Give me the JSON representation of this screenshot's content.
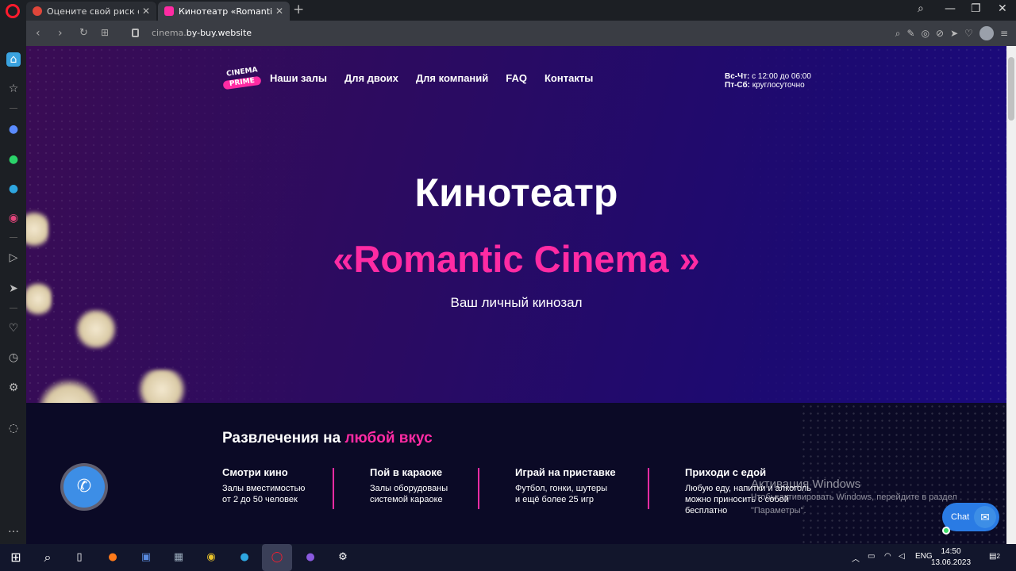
{
  "tabs": [
    {
      "title": "Оцените свой риск стать ж",
      "active": false
    },
    {
      "title": "Кинотеатр «Romantic Cine",
      "active": true
    }
  ],
  "window_controls": {
    "search": "⌕",
    "minimize": "—",
    "restore": "❐",
    "close": "✕"
  },
  "address": {
    "domain_prefix": "cinema.",
    "domain_main": "by-buy.website"
  },
  "page": {
    "logo": {
      "line1": "CINEMA",
      "line2": "PRIME"
    },
    "menu": [
      "Наши залы",
      "Для двоих",
      "Для компаний",
      "FAQ",
      "Контакты"
    ],
    "hours": [
      {
        "days": "Вс-Чт:",
        "time": " с 12:00 до 06:00"
      },
      {
        "days": "Пт-Сб:",
        "time": " круглосуточно"
      }
    ],
    "hero_title": "Кинотеатр",
    "hero_subtitle": "«Romantic Cinema »",
    "hero_tagline": "Ваш личный кинозал",
    "section_title_white": "Развлечения на ",
    "section_title_pink": "любой вкус",
    "features": [
      {
        "title": "Смотри кино",
        "desc": "Залы вместимостью\nот 2 до 50 человек"
      },
      {
        "title": "Пой в караоке",
        "desc": "Залы оборудованы\nсистемой караоке"
      },
      {
        "title": "Играй на приставке",
        "desc": "Футбол, гонки, шутеры\nи ещё более 25 игр"
      },
      {
        "title": "Приходи с едой",
        "desc": "Любую еду, напитки и алкоголь\nможно приносить с собой\nбесплатно"
      }
    ],
    "chat_label": "Chat"
  },
  "watermark": {
    "line1": "Активация Windows",
    "line2": "Чтобы активировать Windows, перейдите в раздел \"Параметры\"."
  },
  "taskbar": {
    "lang": "ENG",
    "time": "14:50",
    "date": "13.06.2023",
    "notif_count": "2"
  },
  "colors": {
    "accent_pink": "#ff2ba3",
    "bg_purple": "#2a0b62",
    "dark_band": "#0b0a26",
    "chat_blue": "#2a7be4"
  }
}
